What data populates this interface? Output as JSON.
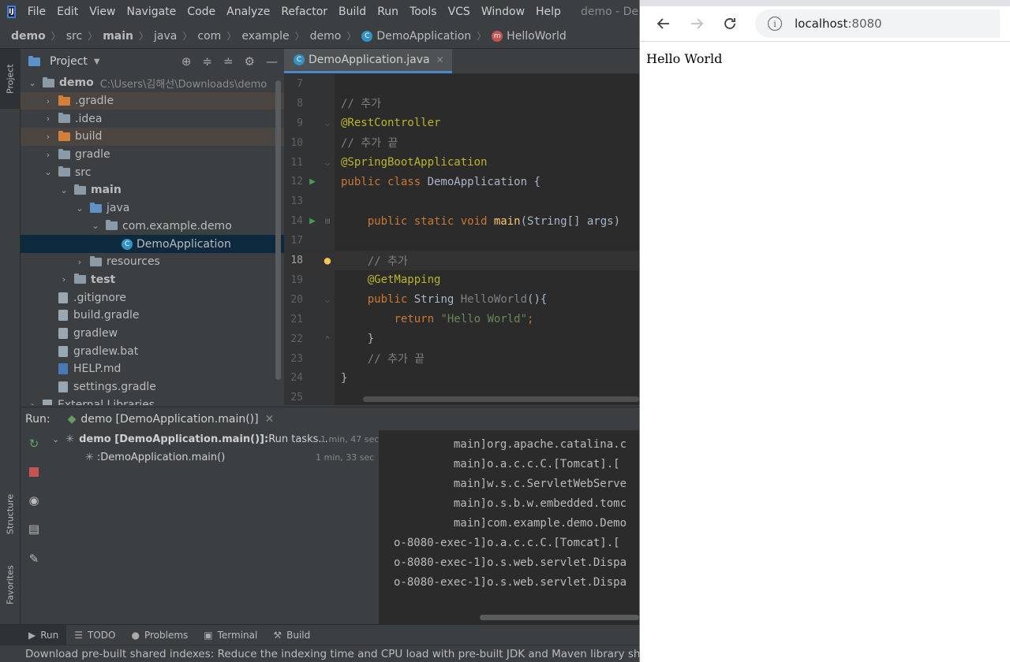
{
  "ide": {
    "menu": [
      "File",
      "Edit",
      "View",
      "Navigate",
      "Code",
      "Analyze",
      "Refactor",
      "Build",
      "Run",
      "Tools",
      "VCS",
      "Window",
      "Help"
    ],
    "window_title": "demo - DemoApp",
    "breadcrumb": [
      "demo",
      "src",
      "main",
      "java",
      "com",
      "example",
      "demo",
      "DemoApplication",
      "HelloWorld"
    ],
    "left_strip": {
      "project": "Project",
      "structure": "Structure",
      "favorites": "Favorites"
    },
    "project_panel": {
      "title": "Project",
      "tree": [
        {
          "label": "demo",
          "path": "C:\\Users\\김해선\\Downloads\\demo"
        },
        {
          "label": ".gradle"
        },
        {
          "label": ".idea"
        },
        {
          "label": "build"
        },
        {
          "label": "gradle"
        },
        {
          "label": "src"
        },
        {
          "label": "main"
        },
        {
          "label": "java"
        },
        {
          "label": "com.example.demo"
        },
        {
          "label": "DemoApplication"
        },
        {
          "label": "resources"
        },
        {
          "label": "test"
        },
        {
          "label": ".gitignore"
        },
        {
          "label": "build.gradle"
        },
        {
          "label": "gradlew"
        },
        {
          "label": "gradlew.bat"
        },
        {
          "label": "HELP.md"
        },
        {
          "label": "settings.gradle"
        },
        {
          "label": "External Libraries"
        }
      ]
    },
    "editor": {
      "tab_label": "DemoApplication.java",
      "line_numbers": [
        "7",
        "8",
        "9",
        "10",
        "11",
        "12",
        "13",
        "14",
        "17",
        "18",
        "19",
        "20",
        "21",
        "22",
        "23",
        "24",
        "25"
      ]
    },
    "run_panel": {
      "label": "Run:",
      "tab": "demo [DemoApplication.main()]",
      "tree": [
        {
          "label": "demo [DemoApplication.main()]:",
          "suffix": " Run tasks...",
          "time": "1 min, 47 sec"
        },
        {
          "label": ":DemoApplication.main()",
          "time": "1 min, 33 sec"
        }
      ],
      "console": [
        {
          "thread": "main]",
          "msg": "org.apache.catalina.c"
        },
        {
          "thread": "main]",
          "msg": "o.a.c.c.C.[Tomcat].["
        },
        {
          "thread": "main]",
          "msg": "w.s.c.ServletWebServe"
        },
        {
          "thread": "main]",
          "msg": "o.s.b.w.embedded.tomc"
        },
        {
          "thread": "main]",
          "msg": "com.example.demo.Demo"
        },
        {
          "thread": "o-8080-exec-1]",
          "msg": "o.a.c.c.C.[Tomcat].["
        },
        {
          "thread": "o-8080-exec-1]",
          "msg": "o.s.web.servlet.Dispa"
        },
        {
          "thread": "o-8080-exec-1]",
          "msg": "o.s.web.servlet.Dispa"
        }
      ]
    },
    "bottom_tabs": [
      "Run",
      "TODO",
      "Problems",
      "Terminal",
      "Build"
    ],
    "status": "Download pre-built shared indexes: Reduce the indexing time and CPU load with pre-built JDK and Maven library shared ind"
  },
  "browser": {
    "url_host": "localhost",
    "url_port": ":8080",
    "body_text": "Hello World"
  }
}
